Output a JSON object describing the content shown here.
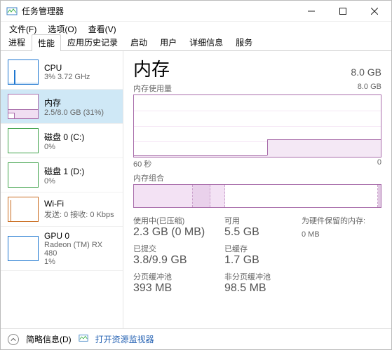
{
  "window": {
    "title": "任务管理器"
  },
  "menu": {
    "file": "文件(F)",
    "options": "选项(O)",
    "view": "查看(V)"
  },
  "tabs": [
    "进程",
    "性能",
    "应用历史记录",
    "启动",
    "用户",
    "详细信息",
    "服务"
  ],
  "active_tab": 1,
  "sidebar": {
    "items": [
      {
        "title": "CPU",
        "sub": "3% 3.72 GHz"
      },
      {
        "title": "内存",
        "sub": "2.5/8.0 GB (31%)"
      },
      {
        "title": "磁盘 0 (C:)",
        "sub": "0%"
      },
      {
        "title": "磁盘 1 (D:)",
        "sub": "0%"
      },
      {
        "title": "Wi-Fi",
        "sub": "发送: 0 接收: 0 Kbps"
      },
      {
        "title": "GPU 0",
        "sub": "Radeon (TM) RX 480",
        "sub2": "1%"
      }
    ],
    "selected": 1
  },
  "detail": {
    "title": "内存",
    "total": "8.0 GB",
    "usage_label": "内存使用量",
    "usage_max": "8.0 GB",
    "timeline_left": "60 秒",
    "timeline_right": "0",
    "composition_label": "内存组合",
    "stats": {
      "in_use_label": "使用中(已压缩)",
      "in_use": "2.3 GB (0 MB)",
      "available_label": "可用",
      "available": "5.5 GB",
      "hw_reserved_label": "为硬件保留的内存:",
      "hw_reserved": "0 MB",
      "committed_label": "已提交",
      "committed": "3.8/9.9 GB",
      "cached_label": "已缓存",
      "cached": "1.7 GB",
      "paged_label": "分页缓冲池",
      "paged": "393 MB",
      "nonpaged_label": "非分页缓冲池",
      "nonpaged": "98.5 MB"
    }
  },
  "footer": {
    "less": "简略信息(D)",
    "resmon": "打开资源监视器"
  },
  "chart_data": {
    "type": "area",
    "title": "内存使用量",
    "ylabel": "GB",
    "ylim": [
      0,
      8.0
    ],
    "x": [
      60,
      55,
      50,
      45,
      40,
      35,
      30,
      28,
      25,
      20,
      15,
      10,
      5,
      0
    ],
    "values": [
      0.1,
      0.1,
      0.1,
      0.1,
      0.1,
      0.1,
      0.1,
      2.3,
      2.3,
      2.3,
      2.3,
      2.3,
      2.3,
      2.3
    ],
    "x_unit": "秒"
  }
}
